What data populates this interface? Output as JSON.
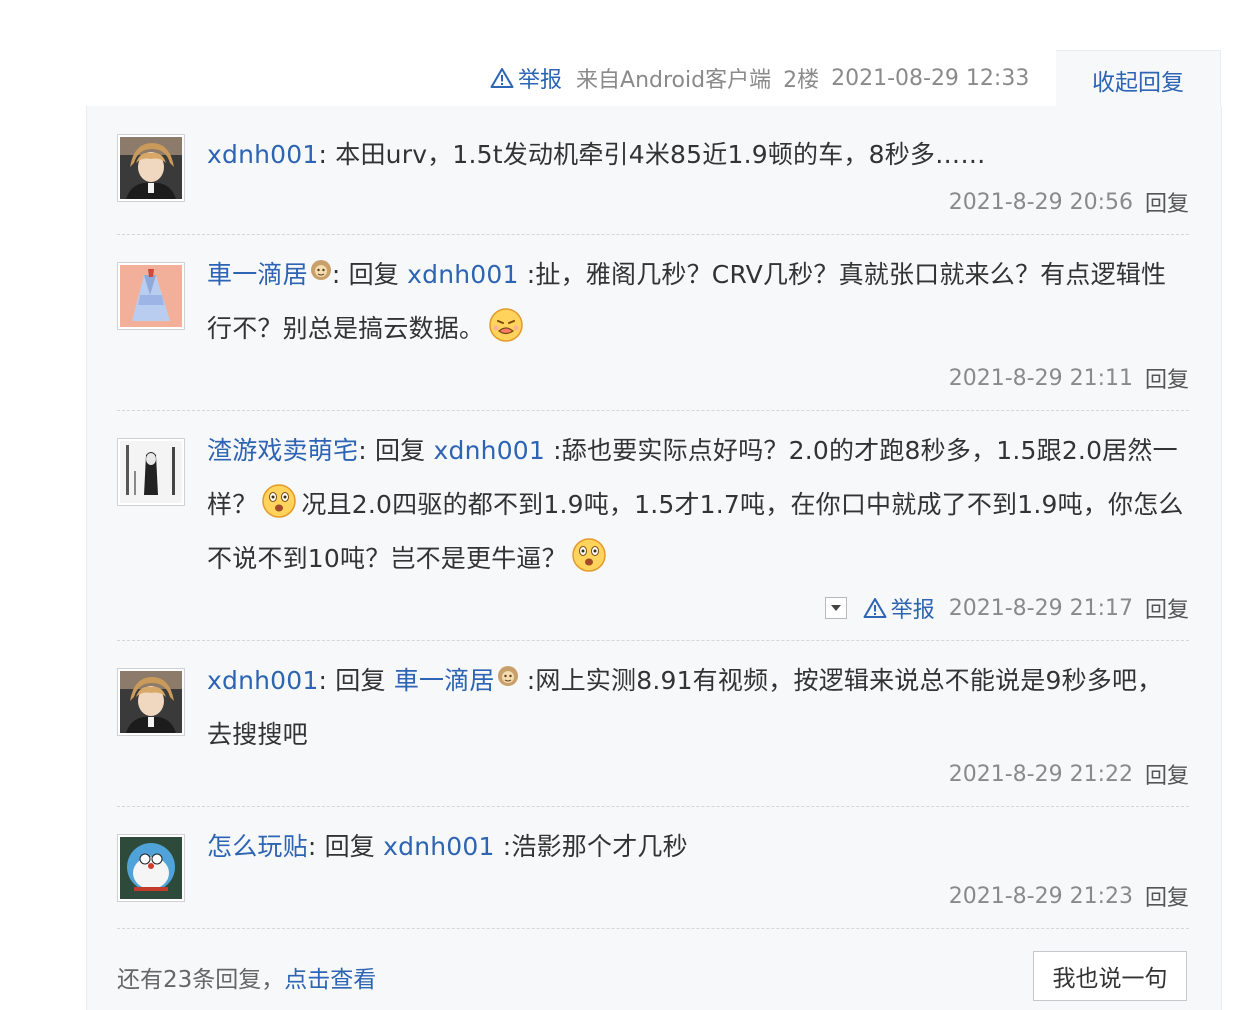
{
  "top": {
    "report_label": "举报",
    "source": "来自Android客户端",
    "floor": "2楼",
    "datetime": "2021-08-29 12:33",
    "collapse_label": "收起回复"
  },
  "replies": [
    {
      "user": "xdnh001",
      "sep": ": ",
      "text": "本田urv，1.5t发动机牵引4米85近1.9顿的车，8秒多……",
      "time": "2021-8-29 20:56",
      "reply_label": "回复"
    },
    {
      "user": "車一滴居",
      "sep": ": ",
      "prefix": "回复 ",
      "target": "xdnh001",
      "text": " :扯，雅阁几秒？CRV几秒？真就张口就来么？有点逻辑性行不？别总是搞云数据。",
      "time": "2021-8-29 21:11",
      "reply_label": "回复"
    },
    {
      "user": "渣游戏卖萌宅",
      "sep": ": ",
      "prefix": "回复 ",
      "target": "xdnh001",
      "text_a": " :舔也要实际点好吗？2.0的才跑8秒多，1.5跟2.0居然一样？",
      "text_b": "况且2.0四驱的都不到1.9吨，1.5才1.7吨，在你口中就成了不到1.9吨，你怎么不说不到10吨？岂不是更牛逼？",
      "report_label": "举报",
      "time": "2021-8-29 21:17",
      "reply_label": "回复"
    },
    {
      "user": "xdnh001",
      "sep": ": ",
      "prefix": "回复 ",
      "target": "車一滴居",
      "text": " :网上实测8.91有视频，按逻辑来说总不能说是9秒多吧，去搜搜吧",
      "time": "2021-8-29 21:22",
      "reply_label": "回复"
    },
    {
      "user": "怎么玩贴",
      "sep": ": ",
      "prefix": "回复 ",
      "target": "xdnh001",
      "text": " :浩影那个才几秒",
      "time": "2021-8-29 21:23",
      "reply_label": "回复"
    }
  ],
  "more": {
    "text": "还有23条回复，",
    "link": "点击查看"
  },
  "say_button": "我也说一句",
  "colors": {
    "link": "#2d64b3",
    "meta": "#8a8a8a",
    "panel_bg": "#f7f8fa"
  },
  "icons": [
    "warning-icon",
    "emoji-face-icon",
    "dropdown-arrow-icon",
    "level-badge-icon"
  ]
}
